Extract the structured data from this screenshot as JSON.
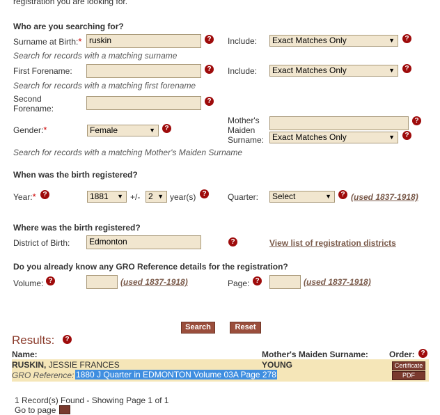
{
  "intro": {
    "text": "registration you are looking for."
  },
  "search": {
    "heading": "Who are you searching for?",
    "surname_label": "Surname at Birth:",
    "surname_value": "ruskin",
    "surname_hint": "Search for records with a matching surname",
    "include_label": "Include:",
    "surname_include": "Exact Matches Only",
    "forename_label": "First Forename:",
    "forename_value": "",
    "forename_hint": "Search for records with a matching first forename",
    "forename_include": "Exact Matches Only",
    "second_label_1": "Second",
    "second_label_2": "Forename:",
    "second_value": "",
    "gender_label": "Gender:",
    "gender_value": "Female",
    "mmn_label_1": "Mother's",
    "mmn_label_2": "Maiden",
    "mmn_label_3": "Surname:",
    "mmn_value": "",
    "mmn_include": "Exact Matches Only",
    "mmn_hint": "Search for records with a matching Mother's Maiden Surname"
  },
  "when": {
    "heading": "When was the birth registered?",
    "year_label": "Year:",
    "year_value": "1881",
    "plusminus": "+/-",
    "range_value": "2",
    "years_label": "year(s)",
    "quarter_label": "Quarter:",
    "quarter_value": "Select",
    "quarter_note": "(used 1837-1918)"
  },
  "where": {
    "heading": "Where was the birth registered?",
    "district_label": "District of Birth:",
    "district_value": "Edmonton",
    "districts_link": "View list of registration districts"
  },
  "gro": {
    "heading": "Do you already know any GRO Reference details for the registration?",
    "volume_label": "Volume:",
    "volume_value": "",
    "volume_note": "(used 1837-1918)",
    "page_label": "Page:",
    "page_value": "",
    "page_note": "(used 1837-1918)"
  },
  "buttons": {
    "search": "Search",
    "reset": "Reset"
  },
  "results": {
    "title": "Results:",
    "col_name": "Name:",
    "col_mmn": "Mother's Maiden Surname:",
    "col_order": "Order:",
    "row": {
      "surname": "RUSKIN,",
      "forenames": "JESSIE  FRANCES",
      "mmn": "YOUNG",
      "gro_label": "GRO Reference:",
      "gro_value": "1880  J Quarter in EDMONTON  Volume 03A  Page 278",
      "certificate": "Certificate",
      "pdf": "PDF"
    },
    "count": "1 Record(s) Found - Showing Page 1 of 1",
    "goto": "Go to page"
  },
  "colors": {
    "accent": "#9a4e3c",
    "help": "#9e0b0b",
    "field_bg": "#f1e6cf",
    "row_bg": "#f5e6b8"
  }
}
